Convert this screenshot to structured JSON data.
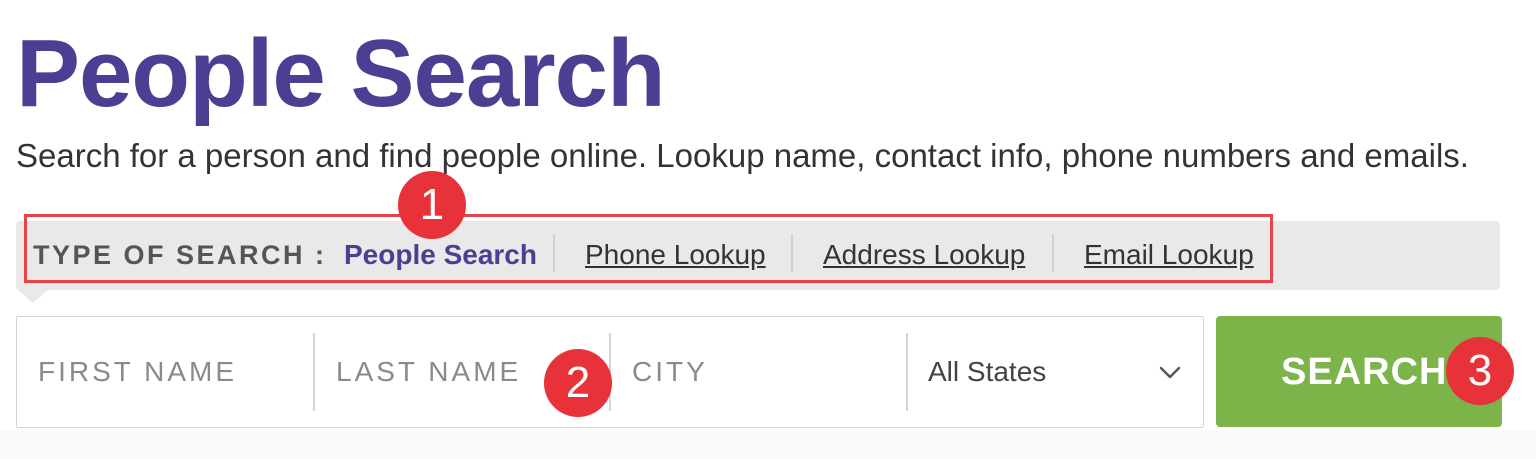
{
  "header": {
    "title": "People Search",
    "subtitle": "Search for a person and find people online. Lookup name, contact info, phone numbers and emails."
  },
  "search_type": {
    "label": "TYPE OF SEARCH :",
    "options": [
      {
        "label": "People Search",
        "active": true
      },
      {
        "label": "Phone Lookup",
        "active": false
      },
      {
        "label": "Address Lookup",
        "active": false
      },
      {
        "label": "Email Lookup",
        "active": false
      }
    ]
  },
  "form": {
    "first_name_placeholder": "FIRST NAME",
    "last_name_placeholder": "LAST NAME",
    "city_placeholder": "CITY",
    "state_value": "All States",
    "search_label": "SEARCH"
  },
  "annotations": {
    "markers": [
      "1",
      "2",
      "3"
    ],
    "highlight_color": "#e8434a"
  },
  "colors": {
    "brand_purple": "#4b3f93",
    "search_green": "#7db44a",
    "marker_red": "#e8323a"
  },
  "icons": {
    "state_dropdown": "chevron-down-icon"
  }
}
